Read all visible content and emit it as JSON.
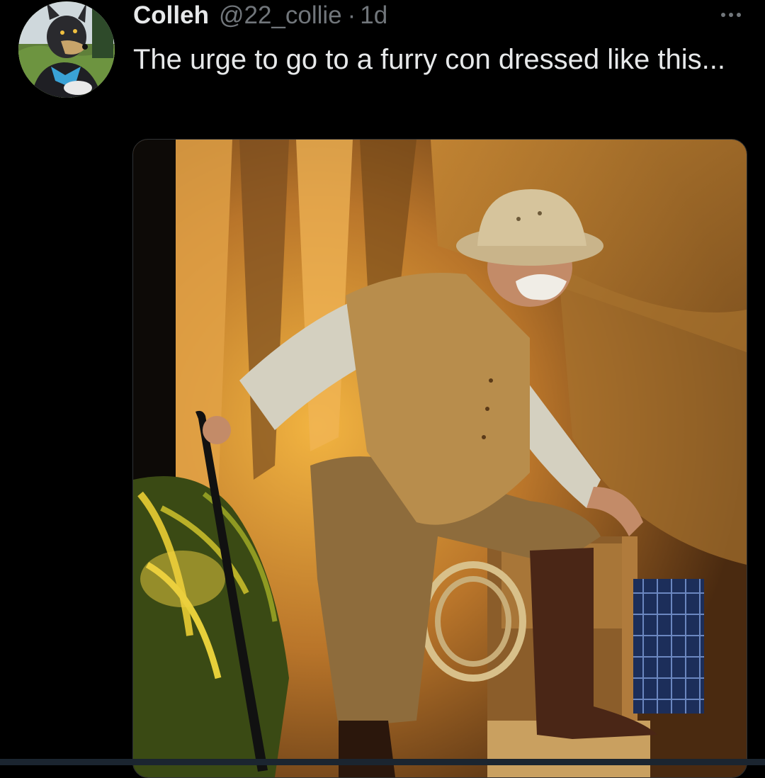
{
  "tweet": {
    "display_name": "Colleh",
    "handle": "@22_collie",
    "separator": "·",
    "time": "1d",
    "text": "The urge to go to a furry con dressed like this..."
  },
  "icons": {
    "more": "more-horizontal-icon"
  },
  "colors": {
    "background": "#000000",
    "primary_text": "#e7e9ea",
    "secondary_text": "#71767b",
    "border": "#2f3336"
  }
}
